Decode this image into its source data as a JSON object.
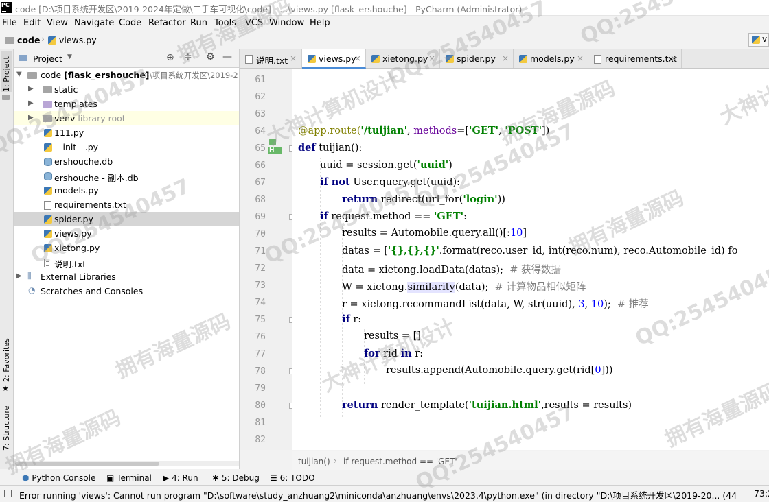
{
  "title_bar": {
    "app_icon_text": "PC",
    "title": "code [D:\\项目系统开发区\\2019-2024年定做\\二手车可视化\\code] - ...\\views.py [flask_ershouche] - PyCharm (Administrator)"
  },
  "menu": [
    "File",
    "Edit",
    "View",
    "Navigate",
    "Code",
    "Refactor",
    "Run",
    "Tools",
    "VCS",
    "Window",
    "Help"
  ],
  "navbar": {
    "crumbs": [
      "code",
      "views.py"
    ],
    "right_button": "v"
  },
  "left_stripe": [
    "1: Project",
    "2: Favorites",
    "7: Structure"
  ],
  "project_panel": {
    "title": "Project",
    "root": {
      "name": "code",
      "module": "[flask_ershouche]",
      "path": "D:\\项目系统开发区\\2019-2"
    },
    "items": [
      {
        "label": "static",
        "type": "folder"
      },
      {
        "label": "templates",
        "type": "folder"
      },
      {
        "label": "venv",
        "suffix": "library root",
        "type": "folder"
      },
      {
        "label": "111.py",
        "type": "py"
      },
      {
        "label": "__init__.py",
        "type": "py"
      },
      {
        "label": "ershouche.db",
        "type": "db"
      },
      {
        "label": "ershouche - 副本.db",
        "type": "db"
      },
      {
        "label": "models.py",
        "type": "py"
      },
      {
        "label": "requirements.txt",
        "type": "txt"
      },
      {
        "label": "spider.py",
        "type": "py"
      },
      {
        "label": "views.py",
        "type": "py"
      },
      {
        "label": "xietong.py",
        "type": "py"
      },
      {
        "label": "说明.txt",
        "type": "txt"
      }
    ],
    "external": "External Libraries",
    "scratches": "Scratches and Consoles"
  },
  "tabs": [
    {
      "label": "说明.txt",
      "type": "txt"
    },
    {
      "label": "views.py",
      "type": "py",
      "active": true
    },
    {
      "label": "xietong.py",
      "type": "py"
    },
    {
      "label": "spider.py",
      "type": "py"
    },
    {
      "label": "models.py",
      "type": "py"
    },
    {
      "label": "requirements.txt",
      "type": "txt"
    }
  ],
  "editor": {
    "line_numbers": [
      "61",
      "62",
      "63",
      "64",
      "65",
      "66",
      "67",
      "68",
      "69",
      "70",
      "71",
      "72",
      "73",
      "74",
      "75",
      "76",
      "77",
      "78",
      "79",
      "80",
      "81",
      "82"
    ],
    "gutter_marker": "H",
    "code": {
      "l64_dec": "@app.route(",
      "l64_s1": "'/tuijian'",
      "l64_mid": ", ",
      "l64_kw": "methods",
      "l64_eq": "=[",
      "l64_s2": "'GET'",
      "l64_c": ", ",
      "l64_s3": "'POST'",
      "l64_end": "])",
      "l65_kw": "def",
      "l65_rest": " tuijian():",
      "l66_a": "uuid = session.get(",
      "l66_s": "'uuid'",
      "l66_b": ")",
      "l67_kw": "if not",
      "l67_rest": " User.query.get(uuid):",
      "l68_kw": "return",
      "l68_a": " redirect(url_for(",
      "l68_s": "'login'",
      "l68_b": "))",
      "l69_kw": "if",
      "l69_a": " request.method == ",
      "l69_s": "'GET'",
      "l69_b": ":",
      "l70_a": "results = Automobile.query.all()[:",
      "l70_n": "10",
      "l70_b": "]",
      "l71_a": "datas = [",
      "l71_s": "'{},{},{}'",
      "l71_b": ".format(reco.user_id, int(reco.num), reco.Automobile_id) fo",
      "l72_a": "data = xietong.loadData(datas);  ",
      "l72_c": "# 获得数据",
      "l73_a": "W = xietong.",
      "l73_h": "similarity",
      "l73_b": "(data);  ",
      "l73_c": "# 计算物品相似矩阵",
      "l74_a": "r = xietong.recommandList(data, W, str(uuid), ",
      "l74_n1": "3",
      "l74_m": ", ",
      "l74_n2": "10",
      "l74_b": ");  ",
      "l74_c": "# 推荐",
      "l75_kw": "if",
      "l75_rest": " r:",
      "l76": "results = []",
      "l77_kw1": "for",
      "l77_a": " rid ",
      "l77_kw2": "in",
      "l77_b": " r:",
      "l78_a": "results.append(Automobile.query.get(rid[",
      "l78_n": "0",
      "l78_b": "]))",
      "l80_kw": "return",
      "l80_a": " render_template(",
      "l80_s": "'tuijian.html'",
      "l80_b": ",results = results)"
    },
    "breadcrumb": [
      "tuijian()",
      "if request.method == 'GET'"
    ]
  },
  "tool_windows": [
    {
      "label": "Python Console"
    },
    {
      "label": "Terminal"
    },
    {
      "label": "4: Run"
    },
    {
      "label": "5: Debug"
    },
    {
      "label": "6: TODO"
    }
  ],
  "status": {
    "message": "Error running 'views': Cannot run program \"D:\\software\\study_anzhuang2\\miniconda\\anzhuang\\envs\\2023.4\\python.exe\" (in directory \"D:\\项目系统开发区\\2019-20... (44 minutes ago)",
    "position": "73:2"
  },
  "watermark": [
    "QQ:254540457",
    "大神计算机设计",
    "拥有海量源码"
  ],
  "colors": {
    "keyword": "#000080",
    "string": "#008000",
    "comment": "#808080",
    "number": "#0000ff",
    "decorator": "#808000",
    "active_tab": "#4a8cd7"
  }
}
